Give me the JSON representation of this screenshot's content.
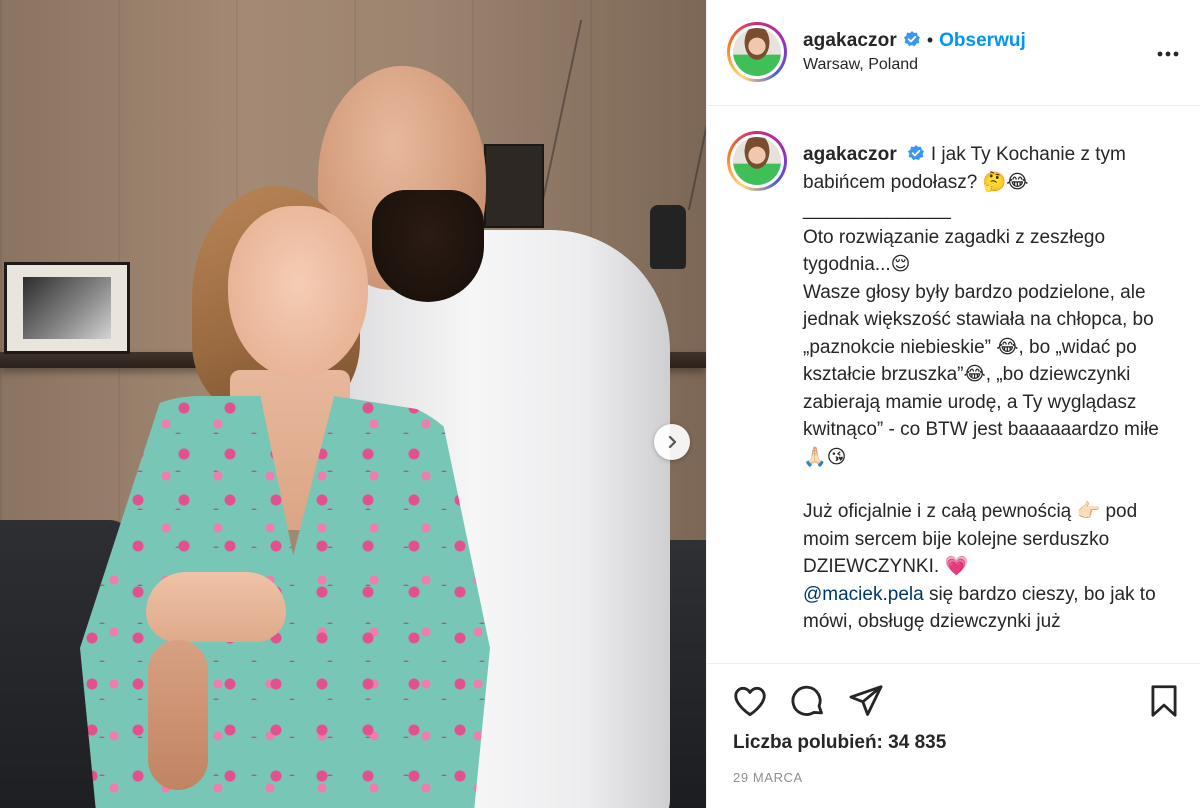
{
  "post": {
    "username": "agakaczor",
    "follow_label": "Obserwuj",
    "separator": "•",
    "location": "Warsaw, Poland",
    "caption": {
      "line1": "I jak Ty Kochanie z tym babińcem podołasz? 🤔😂",
      "divider": "______________",
      "p1": "Oto rozwiązanie zagadki z zeszłego tygodnia...😌",
      "p2": "Wasze głosy były bardzo podzielone, ale jednak większość stawiała na chłopca, bo „paznokcie niebieskie” 😂, bo „widać po kształcie brzuszka”😂, „bo dziewczynki zabierają mamie urodę, a Ty wyglądasz kwitnąco” - co BTW jest baaaaaardzo miłe🙏🏻😘",
      "p3": "Już oficjalnie i z całą pewnością 👉🏻 pod moim sercem bije kolejne serduszko DZIEWCZYNKI. 💗",
      "mention": "@maciek.pela",
      "p4": " się bardzo cieszy, bo jak to mówi, obsługę dziewczynki już"
    },
    "likes_text": "Liczba polubień: 34 835",
    "date": "29 MARCA"
  },
  "icons": {
    "verified": "verified-badge-icon",
    "more": "more-options-icon",
    "next": "chevron-right-icon",
    "like": "heart-icon",
    "comment": "comment-icon",
    "share": "paper-plane-icon",
    "save": "bookmark-icon"
  },
  "colors": {
    "accent": "#0095f6",
    "verified": "#3897f0",
    "text": "#262626",
    "muted": "#8e8e8e",
    "border": "#efefef"
  }
}
